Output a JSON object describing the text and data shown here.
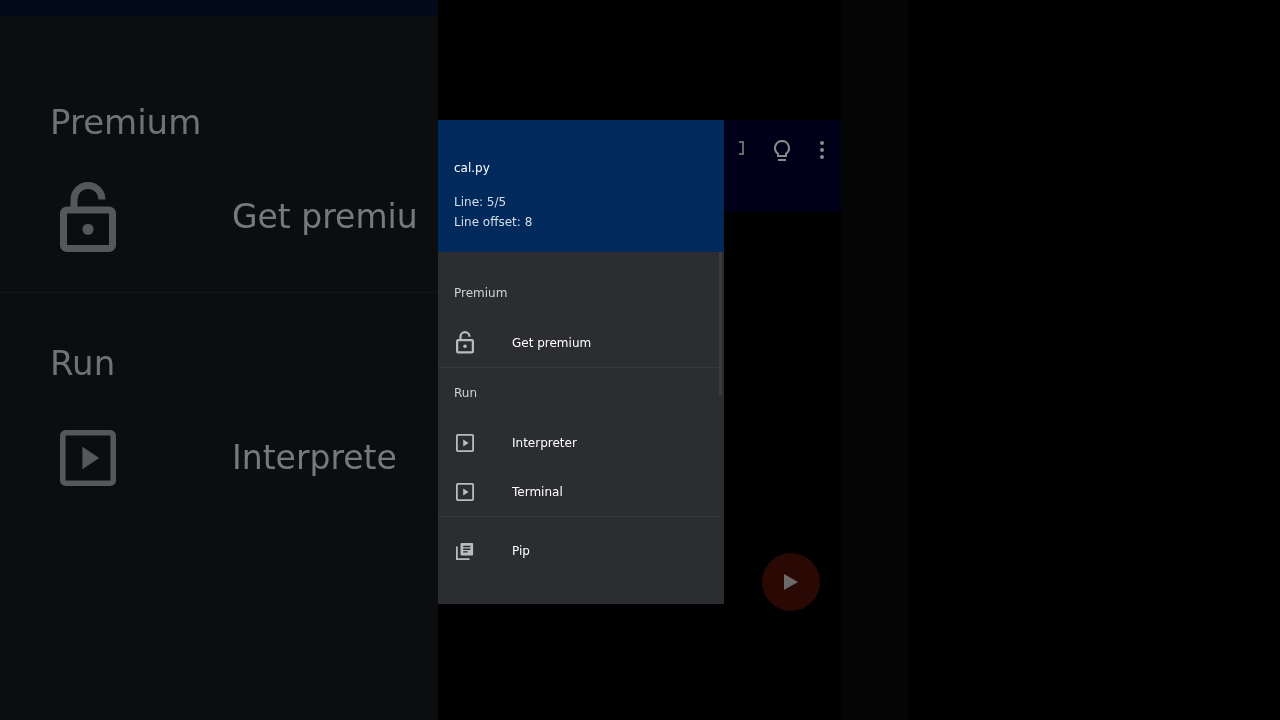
{
  "backdrop": {
    "sections": [
      {
        "title": "Premium",
        "items": [
          {
            "kind": "lock",
            "label": "Get premiu"
          }
        ]
      },
      {
        "title": "Run",
        "items": [
          {
            "kind": "play",
            "label": "Interprete"
          }
        ]
      }
    ]
  },
  "drawer": {
    "header": {
      "file_name": "cal.py",
      "line": "Line: 5/5",
      "line_offset": "Line offset: 8"
    },
    "sections": [
      {
        "title": "Premium",
        "items": [
          {
            "kind": "lock",
            "label": "Get premium"
          }
        ]
      },
      {
        "title": "Run",
        "items": [
          {
            "kind": "play",
            "label": "Interpreter"
          },
          {
            "kind": "play",
            "label": "Terminal"
          }
        ]
      },
      {
        "items": [
          {
            "kind": "library",
            "label": "Pip"
          }
        ]
      }
    ]
  }
}
